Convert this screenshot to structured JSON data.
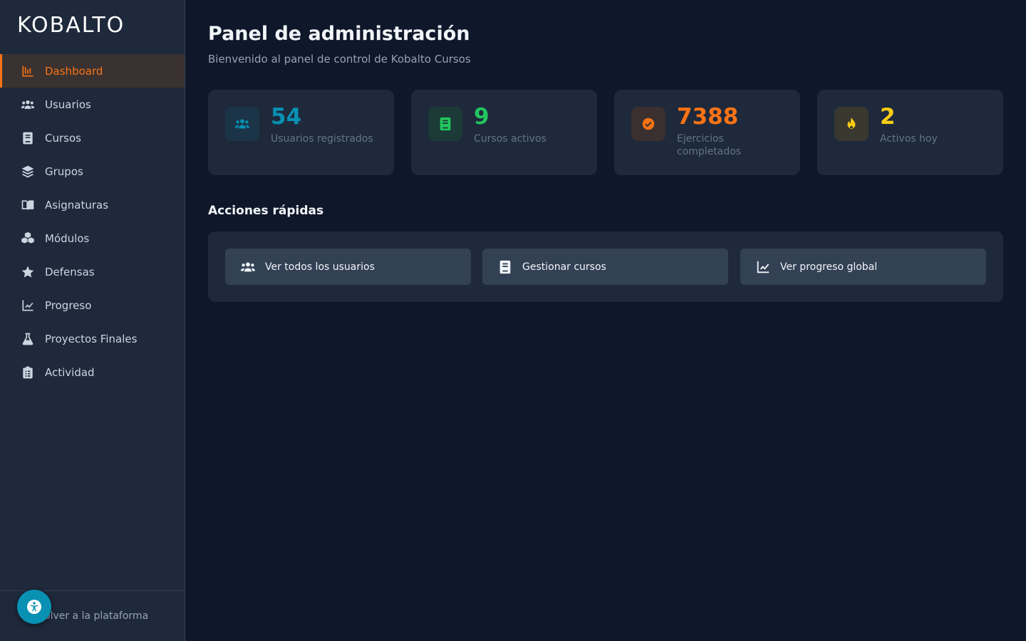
{
  "app": {
    "logo": "KOBALTO"
  },
  "sidebar": {
    "items": [
      {
        "label": "Dashboard",
        "icon": "chart-bar-icon",
        "active": true
      },
      {
        "label": "Usuarios",
        "icon": "users-icon"
      },
      {
        "label": "Cursos",
        "icon": "book-icon"
      },
      {
        "label": "Grupos",
        "icon": "layers-icon"
      },
      {
        "label": "Asignaturas",
        "icon": "book-open-icon"
      },
      {
        "label": "Módulos",
        "icon": "cubes-icon"
      },
      {
        "label": "Defensas",
        "icon": "star-icon"
      },
      {
        "label": "Progreso",
        "icon": "chart-line-icon"
      },
      {
        "label": "Proyectos Finales",
        "icon": "flask-icon"
      },
      {
        "label": "Actividad",
        "icon": "clipboard-list-icon"
      }
    ],
    "footer_link": "olver a la plataforma"
  },
  "header": {
    "title": "Panel de administración",
    "subtitle": "Bienvenido al panel de control de Kobalto Cursos"
  },
  "stats": [
    {
      "value": "54",
      "label": "Usuarios registrados",
      "icon": "users-icon",
      "color": "#0891b2",
      "bg": "#1c3447"
    },
    {
      "value": "9",
      "label": "Cursos activos",
      "icon": "book-icon",
      "color": "#22c55e",
      "bg": "#1b3a38"
    },
    {
      "value": "7388",
      "label": "Ejercicios completados",
      "icon": "check-circle-icon",
      "color": "#f97316",
      "bg": "#3a302f"
    },
    {
      "value": "2",
      "label": "Activos hoy",
      "icon": "fire-icon",
      "color": "#facc15",
      "bg": "#39382f"
    }
  ],
  "quick_actions": {
    "title": "Acciones rápidas",
    "buttons": [
      {
        "label": "Ver todos los usuarios",
        "icon": "users-icon"
      },
      {
        "label": "Gestionar cursos",
        "icon": "book-icon"
      },
      {
        "label": "Ver progreso global",
        "icon": "chart-line-icon"
      }
    ]
  },
  "colors": {
    "accent": "#f97316",
    "background": "#0f172a",
    "card": "#1e293b",
    "button": "#334155"
  }
}
